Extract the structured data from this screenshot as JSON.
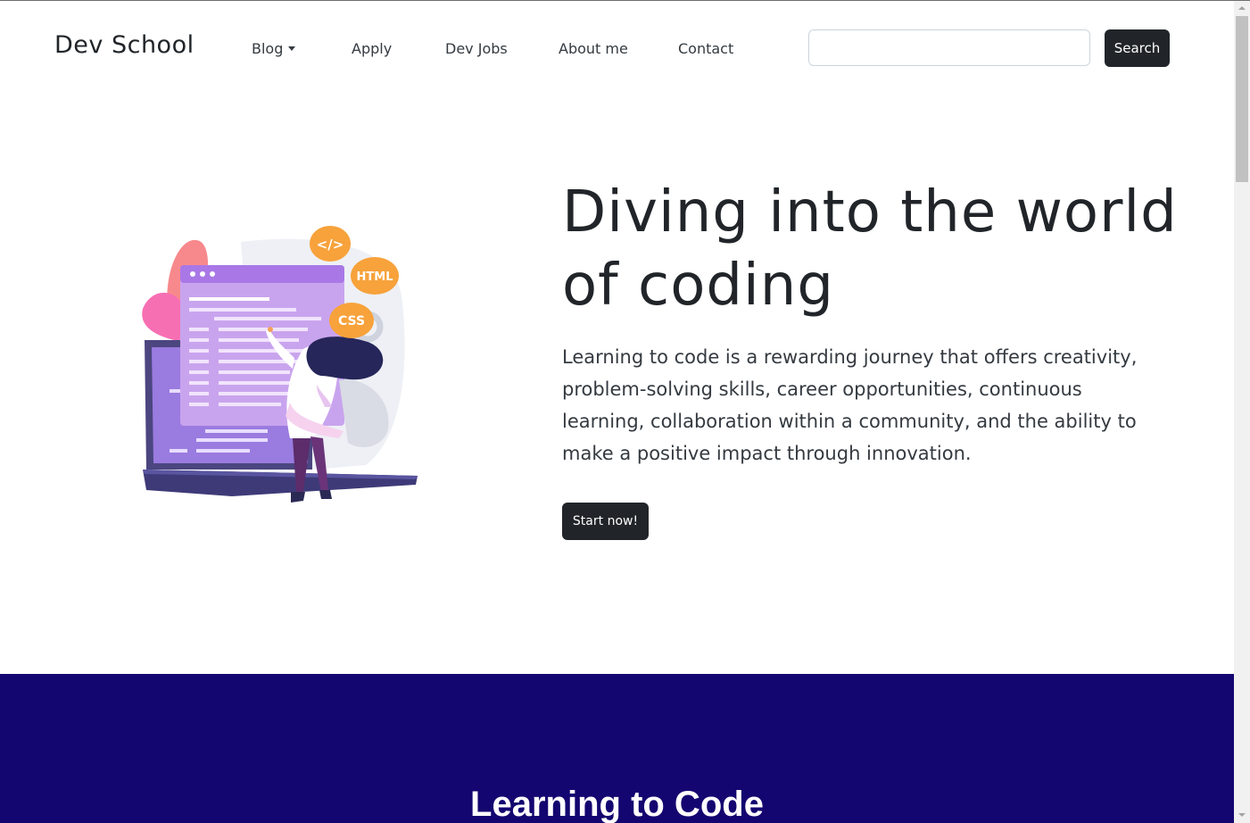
{
  "brand": "Dev School",
  "nav": {
    "items": [
      {
        "label": "Blog"
      },
      {
        "label": "Apply"
      },
      {
        "label": "Dev Jobs"
      },
      {
        "label": "About me"
      },
      {
        "label": "Contact"
      }
    ]
  },
  "search": {
    "value": "",
    "placeholder": "",
    "button_label": "Search"
  },
  "hero": {
    "title": "Diving into the world of coding",
    "text": "Learning to code is a rewarding journey that offers creativity, problem-solving skills, career opportunities, continuous learning, collaboration within a community, and the ability to make a positive impact through innovation.",
    "cta_label": "Start now!",
    "illustration": {
      "badges": [
        "</>",
        "HTML",
        "CSS"
      ]
    }
  },
  "section": {
    "title": "Learning to Code"
  },
  "colors": {
    "dark_button": "#212529",
    "section_bg": "#140670",
    "badge_orange": "#f7a23b"
  }
}
